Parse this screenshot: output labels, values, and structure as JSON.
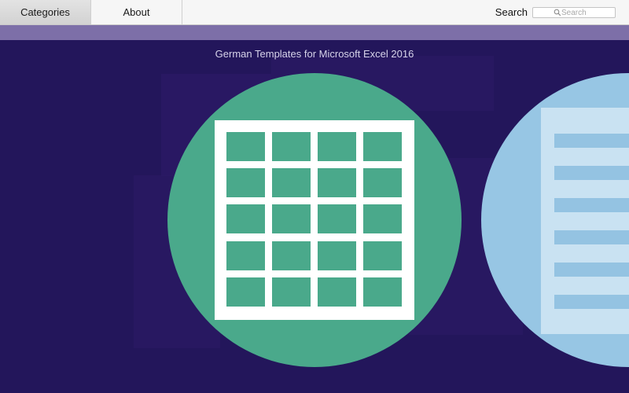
{
  "toolbar": {
    "tabs": [
      {
        "label": "Categories",
        "selected": true
      },
      {
        "label": "About",
        "selected": false
      }
    ],
    "search": {
      "label": "Search",
      "placeholder": "Search",
      "icon": "magnifier-icon"
    }
  },
  "banner": {
    "title": "German Templates for Microsoft Excel 2016"
  },
  "tiles": [
    {
      "name": "spreadsheet",
      "icon": "spreadsheet-grid-icon",
      "color": "#4aa98b"
    },
    {
      "name": "document",
      "icon": "document-lines-icon",
      "color": "#97c6e4"
    }
  ],
  "colors": {
    "background": "#23165b",
    "band": "#7d6fa8",
    "green": "#4aa98b",
    "blue": "#97c6e4"
  }
}
